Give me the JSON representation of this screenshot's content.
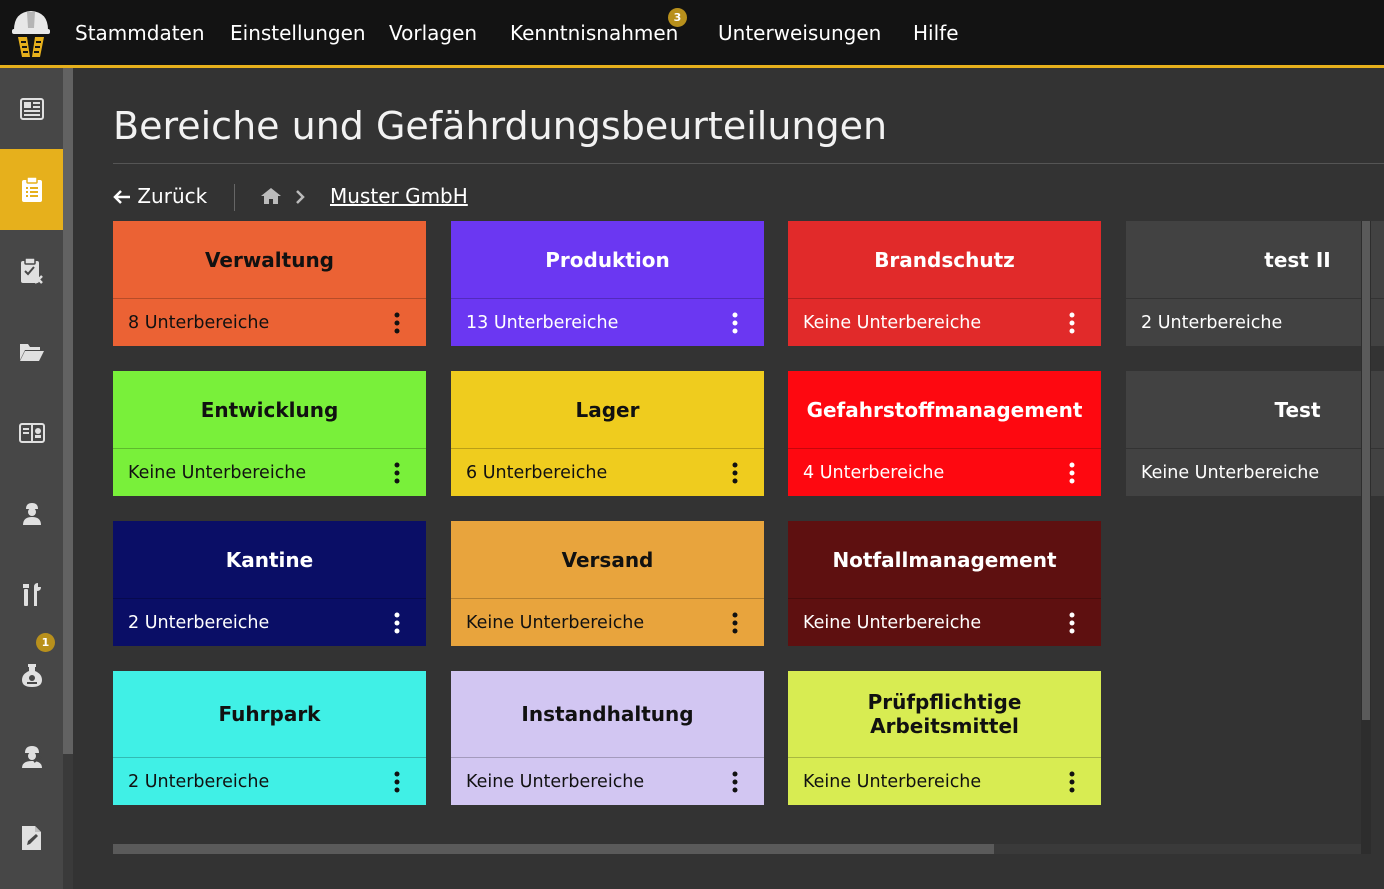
{
  "colors": {
    "accent": "#e6b01c",
    "topbar_bg": "#131313",
    "sidebar_bg": "#474747",
    "main_bg": "#333333"
  },
  "nav": {
    "items": [
      {
        "label": "Stammdaten"
      },
      {
        "label": "Einstellungen"
      },
      {
        "label": "Vorlagen"
      },
      {
        "label": "Kenntnisnahmen",
        "badge": "3"
      },
      {
        "label": "Unterweisungen"
      },
      {
        "label": "Hilfe"
      }
    ]
  },
  "sidebar": {
    "items": [
      {
        "icon": "dashboard-icon"
      },
      {
        "icon": "clipboard-list-icon",
        "active": true
      },
      {
        "icon": "clipboard-check-icon"
      },
      {
        "icon": "folder-open-icon"
      },
      {
        "icon": "book-open-icon"
      },
      {
        "icon": "worker-icon"
      },
      {
        "icon": "tools-icon"
      },
      {
        "icon": "hazard-flask-icon",
        "badge": "1"
      },
      {
        "icon": "instructor-icon"
      },
      {
        "icon": "document-edit-icon"
      }
    ]
  },
  "page": {
    "title": "Bereiche und Gefährdungsbeurteilungen",
    "back_label": "Zurück",
    "breadcrumb_current": "Muster GmbH"
  },
  "cards": [
    {
      "title": "Verwaltung",
      "sub": "8 Unterbereiche",
      "bg": "#eb6234",
      "text": "#111111"
    },
    {
      "title": "Produktion",
      "sub": "13 Unterbereiche",
      "bg": "#6b37f2",
      "text": "#ffffff"
    },
    {
      "title": "Brandschutz",
      "sub": "Keine Unterbereiche",
      "bg": "#e12a2a",
      "text": "#ffffff"
    },
    {
      "title": "test II",
      "sub": "2 Unterbereiche",
      "bg": "#424242",
      "text": "#ffffff"
    },
    {
      "title": "Entwicklung",
      "sub": "Keine Unterbereiche",
      "bg": "#79f03a",
      "text": "#111111"
    },
    {
      "title": "Lager",
      "sub": "6 Unterbereiche",
      "bg": "#efcc1e",
      "text": "#111111"
    },
    {
      "title": "Gefahrstoffmanagement",
      "sub": "4 Unterbereiche",
      "bg": "#fe0810",
      "text": "#ffffff"
    },
    {
      "title": "Test",
      "sub": "Keine Unterbereiche",
      "bg": "#424242",
      "text": "#ffffff"
    },
    {
      "title": "Kantine",
      "sub": "2 Unterbereiche",
      "bg": "#0a0e66",
      "text": "#ffffff"
    },
    {
      "title": "Versand",
      "sub": "Keine Unterbereiche",
      "bg": "#e8a43d",
      "text": "#111111"
    },
    {
      "title": "Notfallmanagement",
      "sub": "Keine Unterbereiche",
      "bg": "#5e1010",
      "text": "#ffffff"
    },
    {
      "title": "Fuhrpark",
      "sub": "2 Unterbereiche",
      "bg": "#40f0e6",
      "text": "#111111"
    },
    {
      "title": "Instandhaltung",
      "sub": "Keine Unterbereiche",
      "bg": "#d2c6f2",
      "text": "#111111"
    },
    {
      "title": "Prüfpflichtige Arbeitsmittel",
      "sub": "Keine Unterbereiche",
      "bg": "#d8ec52",
      "text": "#111111"
    }
  ]
}
